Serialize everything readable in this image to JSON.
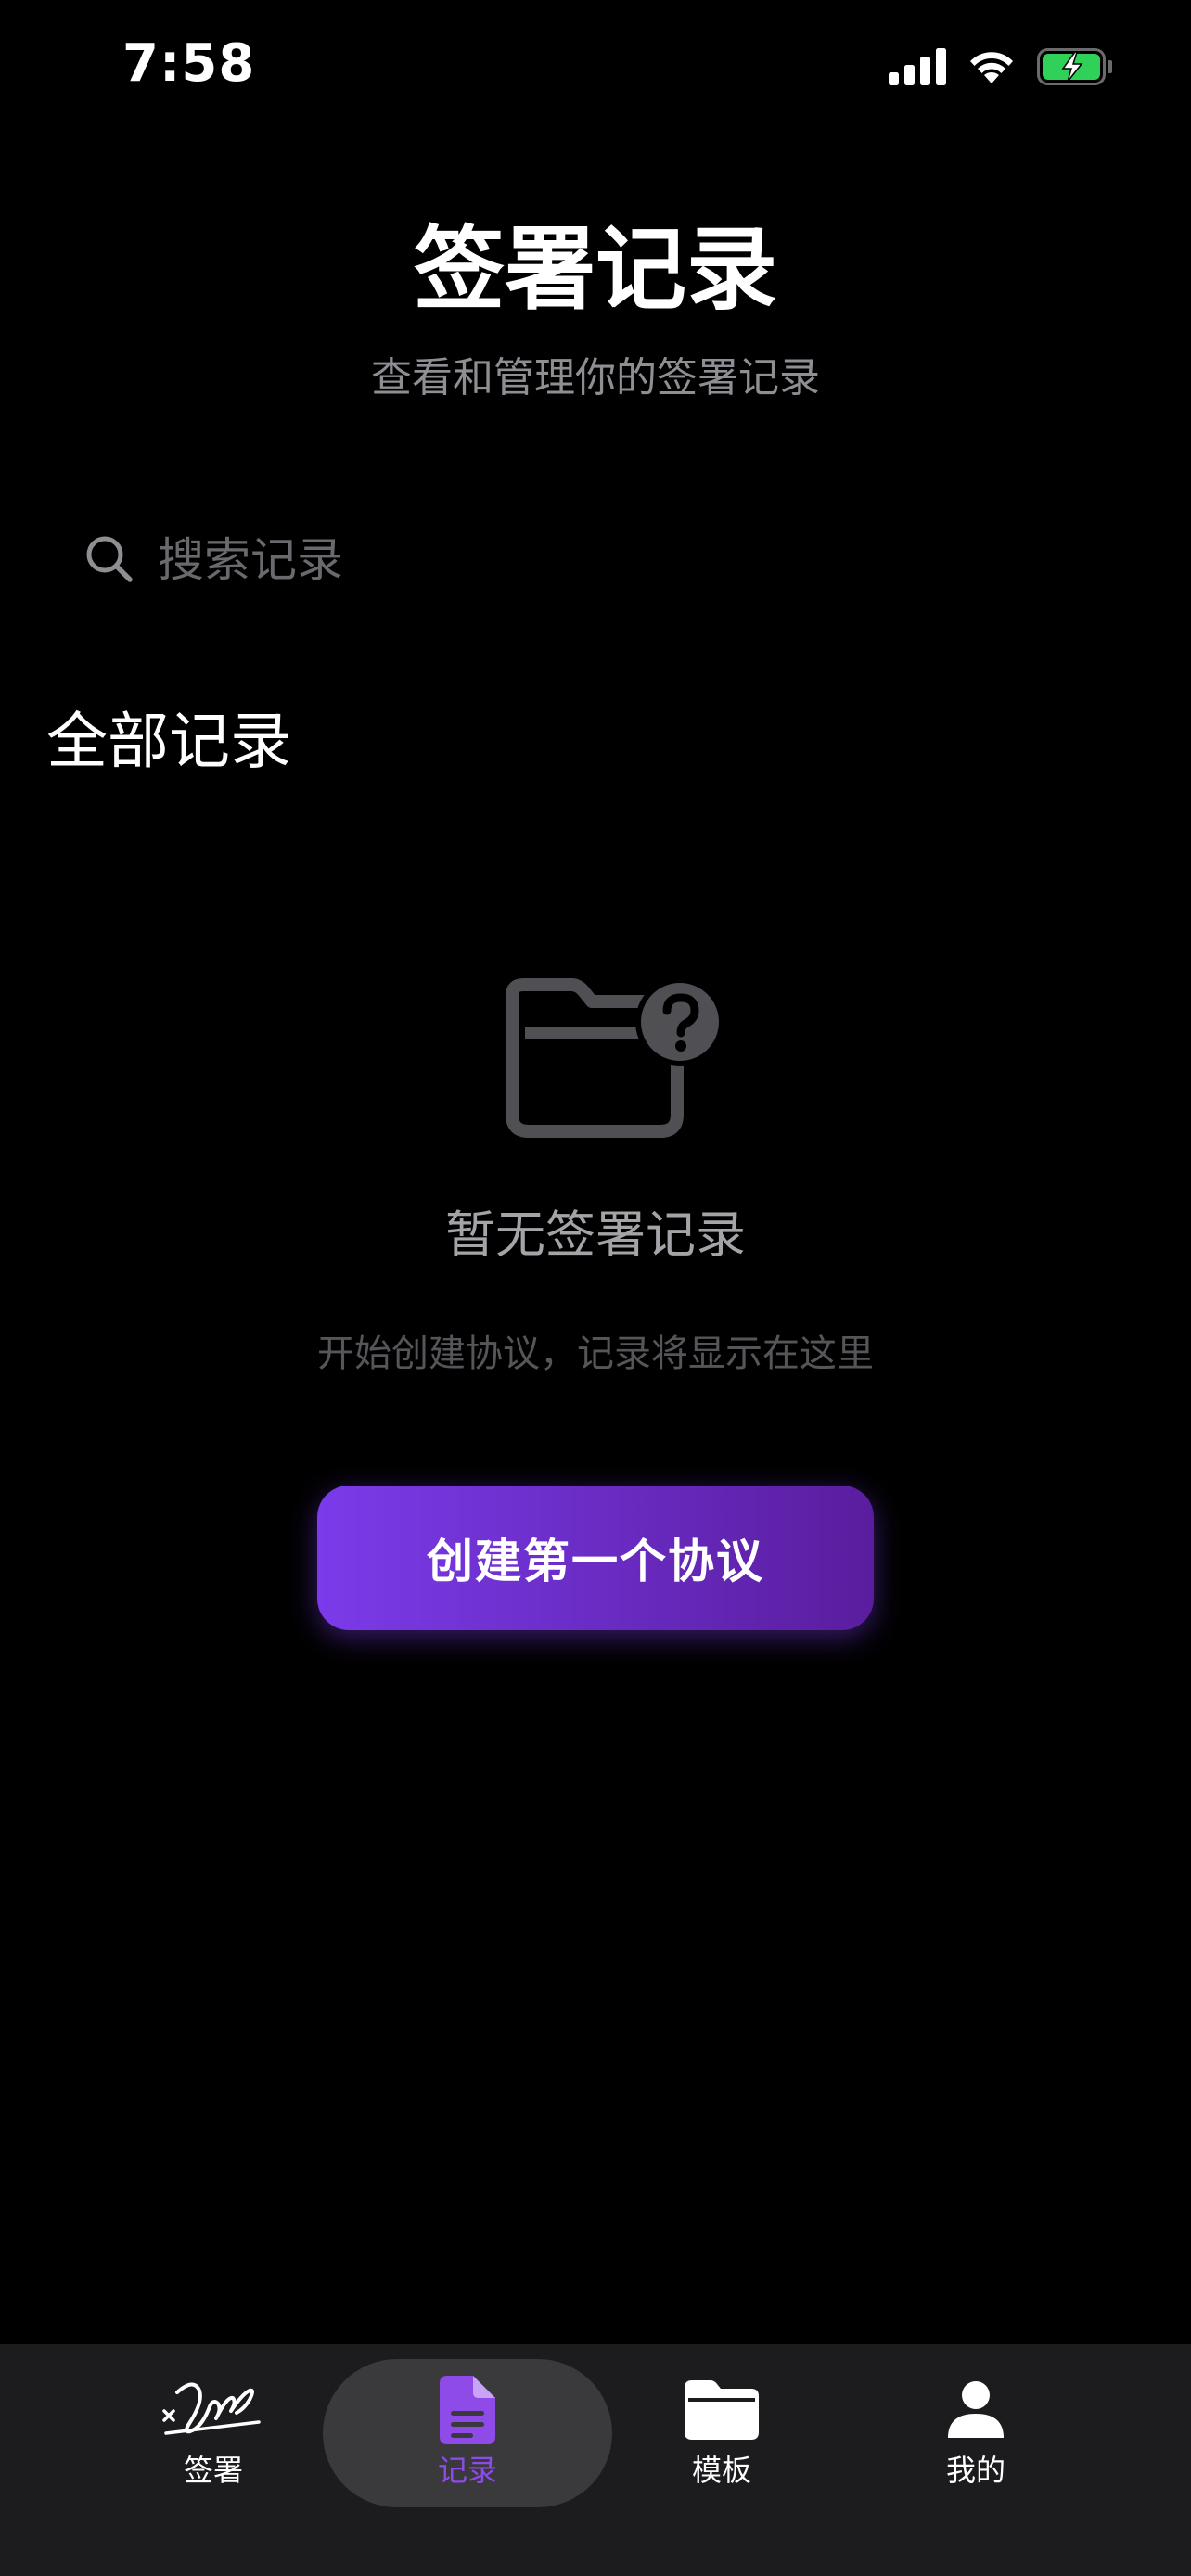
{
  "status_bar": {
    "time": "7:58"
  },
  "header": {
    "title": "签署记录",
    "subtitle": "查看和管理你的签署记录"
  },
  "search": {
    "placeholder": "搜索记录"
  },
  "section": {
    "title": "全部记录"
  },
  "empty_state": {
    "icon": "folder-question-icon",
    "title": "暂无签署记录",
    "description": "开始创建协议，记录将显示在这里",
    "button_label": "创建第一个协议"
  },
  "tab_bar": {
    "active_index": 1,
    "items": [
      {
        "label": "签署",
        "icon": "signature-icon"
      },
      {
        "label": "记录",
        "icon": "document-icon"
      },
      {
        "label": "模板",
        "icon": "folder-icon"
      },
      {
        "label": "我的",
        "icon": "person-icon"
      }
    ]
  },
  "colors": {
    "background": "#000000",
    "accent": "#7b3bea",
    "tab_bar_bg": "#1c1c1e",
    "battery_green": "#30d158"
  }
}
